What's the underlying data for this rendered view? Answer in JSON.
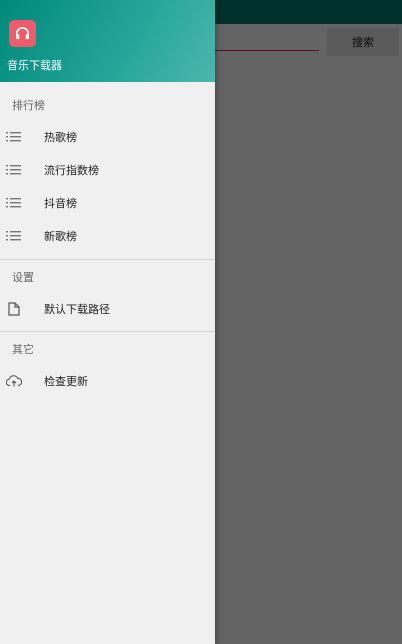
{
  "app": {
    "name": "音乐下载器",
    "header_color": "#00897b",
    "logo_color": "#ef5b6b",
    "logo_icon": "headphones-icon"
  },
  "background": {
    "search_button_label": "搜索",
    "input_value": "",
    "accent": "#e91e63"
  },
  "drawer": {
    "sections": [
      {
        "title": "排行榜",
        "items": [
          {
            "label": "热歌榜",
            "icon": "list-icon"
          },
          {
            "label": "流行指数榜",
            "icon": "list-icon"
          },
          {
            "label": "抖音榜",
            "icon": "list-icon"
          },
          {
            "label": "新歌榜",
            "icon": "list-icon"
          }
        ]
      },
      {
        "title": "设置",
        "items": [
          {
            "label": "默认下载路径",
            "icon": "file-icon"
          }
        ]
      },
      {
        "title": "其它",
        "items": [
          {
            "label": "检查更新",
            "icon": "cloud-upload-icon"
          }
        ]
      }
    ]
  }
}
